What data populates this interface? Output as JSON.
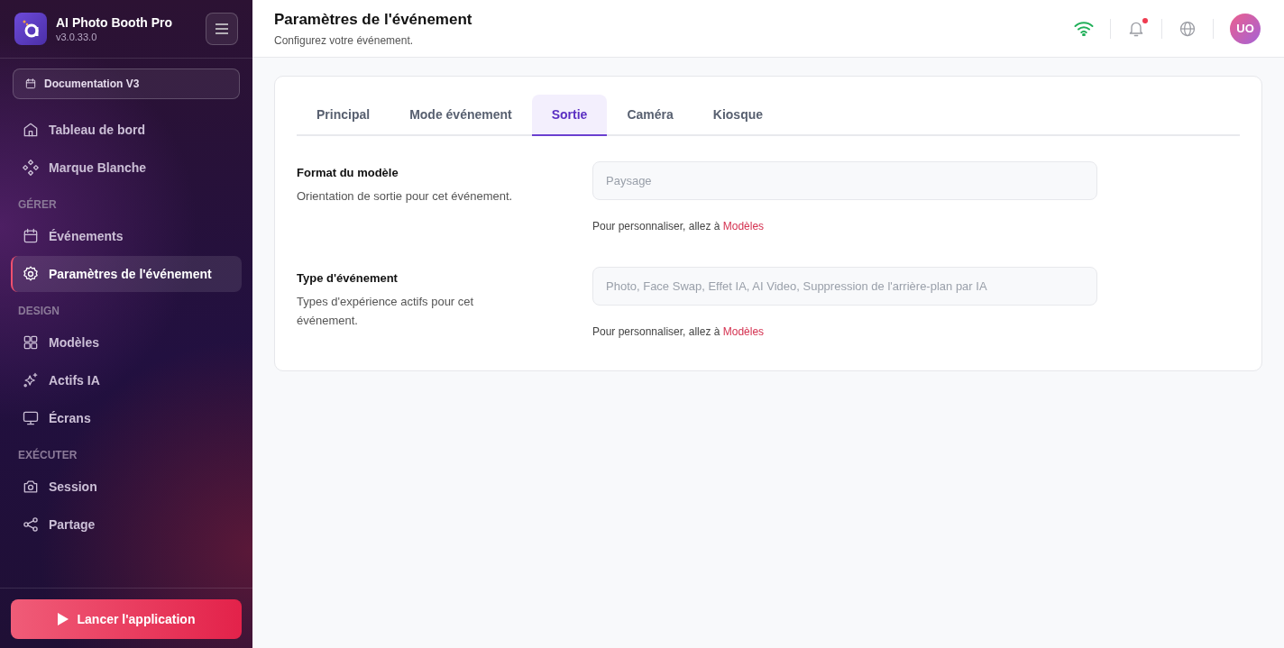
{
  "app": {
    "name": "AI Photo Booth Pro",
    "version": "v3.0.33.0"
  },
  "event_selector": {
    "label": "Documentation V3"
  },
  "sidebar": {
    "sections": [
      {
        "items": [
          {
            "label": "Tableau de bord",
            "selected": false
          },
          {
            "label": "Marque Blanche",
            "selected": false
          }
        ]
      },
      {
        "heading": "GÉRER",
        "items": [
          {
            "label": "Événements",
            "selected": false
          },
          {
            "label": "Paramètres de l'événement",
            "selected": true
          }
        ]
      },
      {
        "heading": "DESIGN",
        "items": [
          {
            "label": "Modèles",
            "selected": false
          },
          {
            "label": "Actifs IA",
            "selected": false
          },
          {
            "label": "Écrans",
            "selected": false
          }
        ]
      },
      {
        "heading": "EXÉCUTER",
        "items": [
          {
            "label": "Session",
            "selected": false
          },
          {
            "label": "Partage",
            "selected": false
          }
        ]
      }
    ],
    "launch_button": "Lancer l'application"
  },
  "header": {
    "title": "Paramètres de l'événement",
    "subtitle": "Configurez votre événement.",
    "notification_unread": true,
    "avatar": "UO"
  },
  "tabs": [
    {
      "label": "Principal",
      "selected": false
    },
    {
      "label": "Mode événement",
      "selected": false
    },
    {
      "label": "Sortie",
      "selected": true
    },
    {
      "label": "Caméra",
      "selected": false
    },
    {
      "label": "Kiosque",
      "selected": false
    }
  ],
  "settings": [
    {
      "title": "Format du modèle",
      "description": "Orientation de sortie pour cet événement.",
      "value": "Paysage",
      "disabled": true,
      "hint": "Pour personnaliser, allez à",
      "link": "Modèles"
    },
    {
      "title": "Type d'événement",
      "description": "Types d'expérience actifs pour cet événement.",
      "value": "Photo, Face Swap, Effet IA, AI Video, Suppression de l'arrière-plan par IA",
      "disabled": true,
      "hint": "Pour personnaliser, allez à",
      "link": "Modèles"
    }
  ]
}
